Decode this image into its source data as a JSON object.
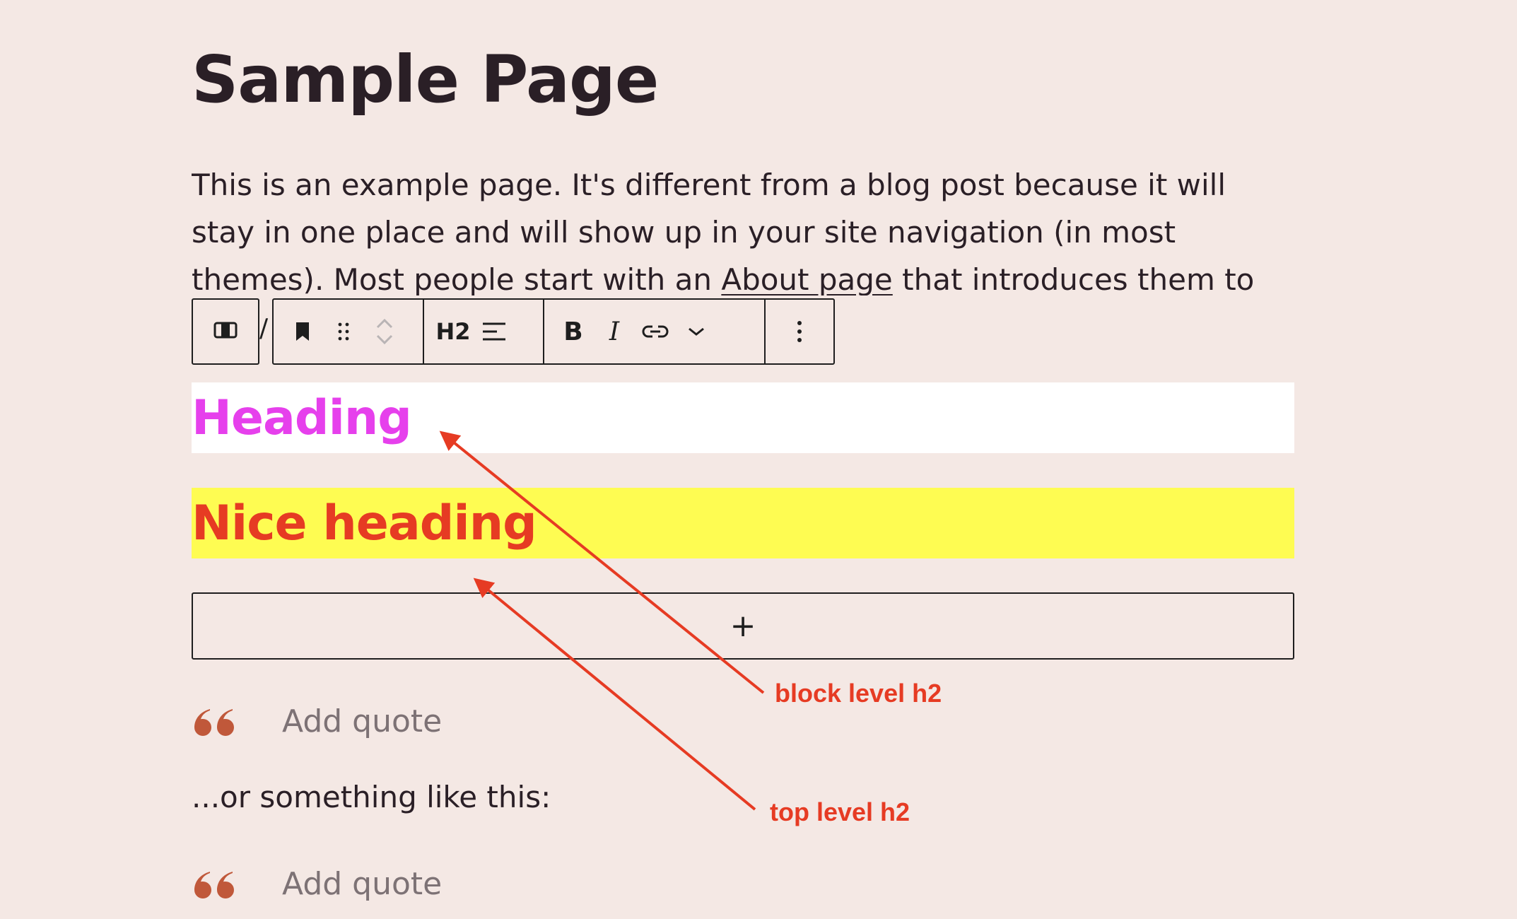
{
  "page": {
    "title": "Sample Page",
    "intro_before_link": "This is an example page. It's different from a blog post because it will stay in one place and will show up in your site navigation (in most themes). Most people start with an ",
    "intro_link": "About page",
    "intro_after_link": " that introduces them to potential"
  },
  "toolbar": {
    "heading_level": "H2",
    "overflow_glyph": "/"
  },
  "blocks": {
    "heading1": "Heading",
    "heading2": "Nice heading",
    "appender_symbol": "+",
    "quote1_placeholder": "Add quote",
    "aside": "...or something like this:",
    "quote2_placeholder": "Add quote"
  },
  "annotations": {
    "block_level": "block level h2",
    "top_level": "top level h2"
  },
  "colors": {
    "background": "#f4e8e4",
    "heading1_text": "#e640ec",
    "heading2_text": "#e63b23",
    "heading2_bg": "#fefc52",
    "annotation": "#e63b23",
    "quote_mark": "#c0583a"
  },
  "icons": [
    "block-type-icon",
    "bookmark-icon",
    "drag-handle-icon",
    "move-up-icon",
    "move-down-icon",
    "align-left-icon",
    "link-icon",
    "chevron-down-icon",
    "more-options-icon",
    "quote-mark-icon"
  ]
}
